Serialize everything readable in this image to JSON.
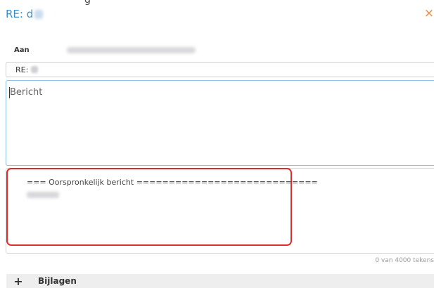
{
  "header": {
    "subject_title": "RE: d",
    "close_icon": "×"
  },
  "recipients": {
    "to_label": "Aan"
  },
  "subject_field": {
    "value": "RE:"
  },
  "message": {
    "placeholder": "Bericht"
  },
  "original_message": {
    "header_line": "=== Oorspronkelijk bericht ============================"
  },
  "counter": {
    "text": "0 van 4000 tekens"
  },
  "attachments": {
    "icon": "+",
    "label": "Bijlagen"
  },
  "colors": {
    "title_blue": "#3a8fc9",
    "close_orange": "#f0873a",
    "highlight_red": "#e02b2b",
    "focus_blue": "#8fbde3"
  }
}
